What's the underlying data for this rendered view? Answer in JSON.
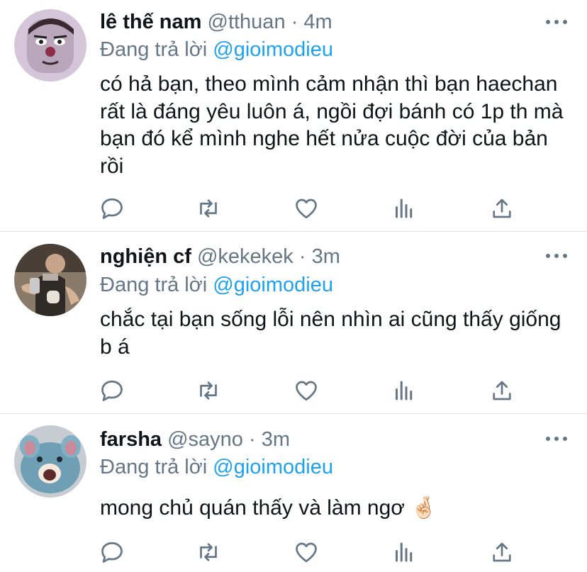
{
  "tweets": [
    {
      "name": "lê thế nam",
      "handle": "@tthuan",
      "separator": "·",
      "time": "4m",
      "reply_prefix": "Đang trả lời ",
      "reply_to": "@gioimodieu",
      "text": "có hả bạn, theo mình cảm nhận thì bạn haechan rất là đáng yêu luôn á, ngồi đợi bánh có 1p th mà bạn đó kể mình nghe hết nửa cuộc đời của bản rồi",
      "avatar": "cartoon-character-avatar"
    },
    {
      "name": "nghiện cf",
      "handle": "@kekekek",
      "separator": "·",
      "time": "3m",
      "reply_prefix": "Đang trả lời ",
      "reply_to": "@gioimodieu",
      "text": "chắc tại bạn sống lỗi nên nhìn ai cũng thấy giống b á",
      "avatar": "barista-photo-avatar"
    },
    {
      "name": "farsha",
      "handle": "@sayno",
      "separator": "·",
      "time": "3m",
      "reply_prefix": "Đang trả lời ",
      "reply_to": "@gioimodieu",
      "text": "mong chủ quán thấy và làm ngơ 🤞🏻",
      "avatar": "blue-rat-avatar"
    }
  ],
  "colors": {
    "text": "#0f1419",
    "secondary": "#657786",
    "accent": "#1da1f2",
    "divider": "#dfe3e6"
  },
  "icons": [
    "reply-icon",
    "retweet-icon",
    "like-icon",
    "analytics-icon",
    "share-icon",
    "more-icon"
  ]
}
